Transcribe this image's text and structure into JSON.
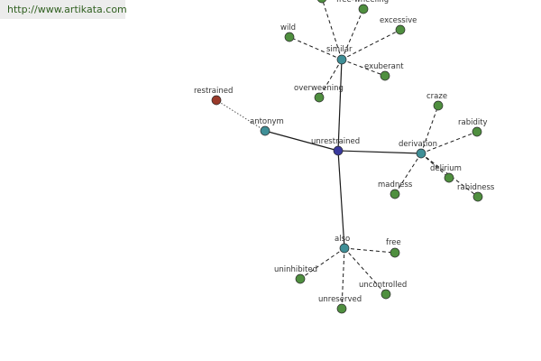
{
  "source_url": "http://www.artikata.com",
  "colors": {
    "center": "#3a3a9e",
    "hub": "#3f8f97",
    "leaf": "#4f8f3f",
    "antonym_leaf": "#9a3a2a"
  },
  "nodes": {
    "unrestrained": "unrestrained",
    "similar": "similar",
    "antonym": "antonym",
    "derivation": "derivation",
    "also": "also",
    "restrained": "restrained",
    "wild": "wild",
    "freewheeling": "free-wheeling",
    "excessive": "excessive",
    "exuberant": "exuberant",
    "overweening": "overweening",
    "craze": "craze",
    "rabidity": "rabidity",
    "delirium": "delirium",
    "rabidness": "rabidness",
    "madness": "madness",
    "free": "free",
    "uninhibited": "uninhibited",
    "uncontrolled": "uncontrolled",
    "unreserved": "unreserved"
  }
}
